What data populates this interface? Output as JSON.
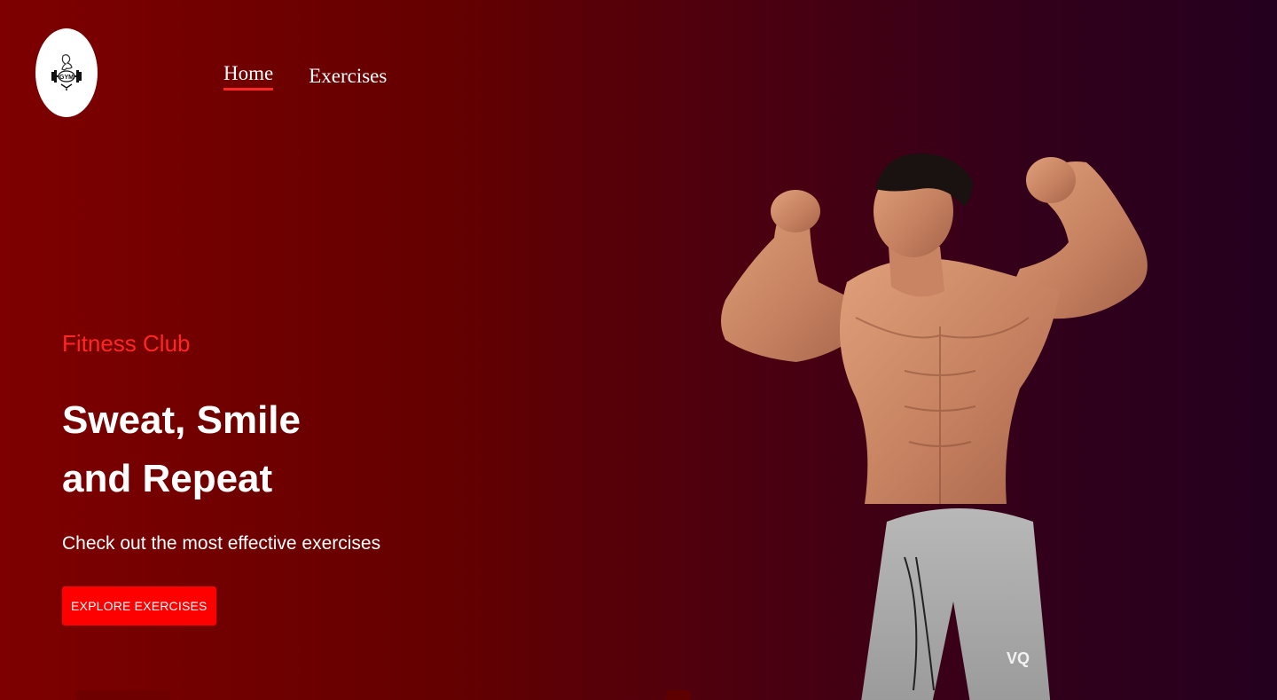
{
  "logo": {
    "icon": "gym-dumbbell-logo-icon",
    "text": "GYM"
  },
  "nav": {
    "items": [
      {
        "label": "Home",
        "active": true
      },
      {
        "label": "Exercises",
        "active": false
      }
    ]
  },
  "hero": {
    "eyebrow": "Fitness Club",
    "headline_line1": "Sweat, Smile",
    "headline_line2": "and Repeat",
    "subtitle": "Check out the most effective exercises",
    "cta_label": "Explore Exercises",
    "image": "bodybuilder-flexing-image",
    "brand_mark": "VQ"
  },
  "colors": {
    "accent": "#ff2625",
    "button": "#ff0000",
    "bg_left": "#7e0000",
    "bg_right": "#24001e"
  }
}
